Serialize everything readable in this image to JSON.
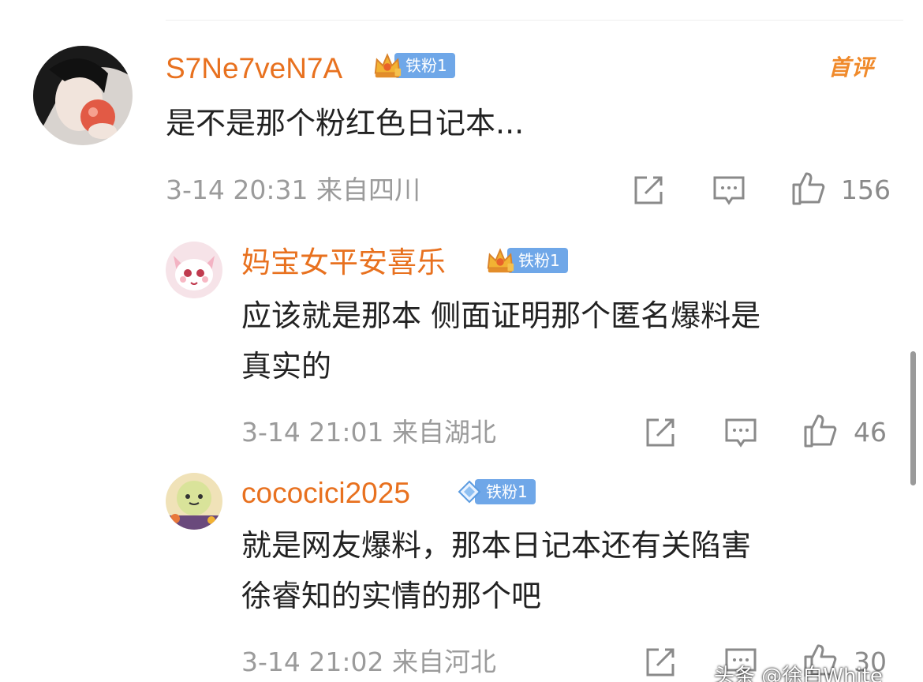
{
  "comments": [
    {
      "username": "S7Ne7veN7A",
      "badge_label": "铁粉1",
      "badge_icon": "crown-icon",
      "tag": "首评",
      "text_lines": [
        "是不是那个粉红色日记本..."
      ],
      "time": "3-14 20:31 来自四川",
      "likes": "156"
    },
    {
      "username": "妈宝女平安喜乐",
      "badge_label": "铁粉1",
      "badge_icon": "crown-icon",
      "text_lines": [
        "应该就是那本 侧面证明那个匿名爆料是",
        "真实的"
      ],
      "time": "3-14 21:01 来自湖北",
      "likes": "46"
    },
    {
      "username": "cococici2025",
      "badge_label": "铁粉1",
      "badge_icon": "diamond-icon",
      "text_lines": [
        "就是网友爆料，那本日记本还有关陷害",
        "徐睿知的实情的那个吧"
      ],
      "time": "3-14 21:02 来自河北",
      "likes": "30"
    }
  ],
  "watermark": "头条 @徐白White",
  "colors": {
    "username": "#e8711f",
    "badge_bg": "#6fa7e8",
    "meta_text": "#9b9b9b",
    "first_tag": "#f08a2b"
  }
}
